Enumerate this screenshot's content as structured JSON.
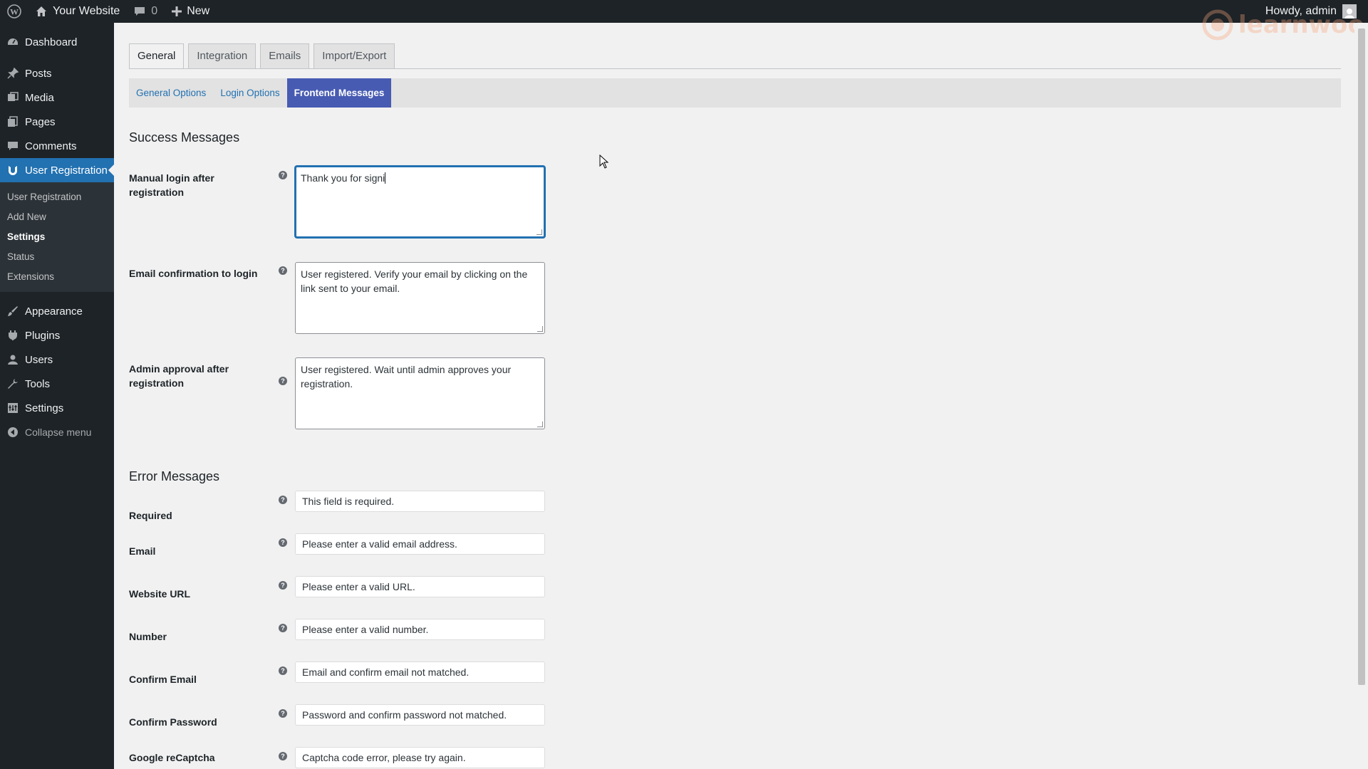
{
  "adminbar": {
    "site_name": "Your Website",
    "comments_count": "0",
    "new_label": "New",
    "howdy": "Howdy, admin"
  },
  "sidebar": {
    "items": [
      {
        "label": "Dashboard",
        "icon": "dashboard-icon"
      },
      {
        "label": "Posts",
        "icon": "pin-icon"
      },
      {
        "label": "Media",
        "icon": "media-icon"
      },
      {
        "label": "Pages",
        "icon": "pages-icon"
      },
      {
        "label": "Comments",
        "icon": "comment-icon"
      },
      {
        "label": "User Registration",
        "icon": "user-registration-icon"
      }
    ],
    "submenu": [
      "User Registration",
      "Add New",
      "Settings",
      "Status",
      "Extensions"
    ],
    "items2": [
      {
        "label": "Appearance",
        "icon": "brush-icon"
      },
      {
        "label": "Plugins",
        "icon": "plug-icon"
      },
      {
        "label": "Users",
        "icon": "users-icon"
      },
      {
        "label": "Tools",
        "icon": "wrench-icon"
      },
      {
        "label": "Settings",
        "icon": "settings-icon"
      }
    ],
    "collapse": "Collapse menu"
  },
  "tabs": [
    "General",
    "Integration",
    "Emails",
    "Import/Export"
  ],
  "subtabs": [
    "General Options",
    "Login Options",
    "Frontend Messages"
  ],
  "success": {
    "title": "Success Messages",
    "fields": [
      {
        "label": "Manual login after registration",
        "value": "Thank you for signi"
      },
      {
        "label": "Email confirmation to login",
        "value": "User registered. Verify your email by clicking on the link sent to your email."
      },
      {
        "label": "Admin approval after registration",
        "value": "User registered. Wait until admin approves your registration."
      }
    ]
  },
  "error": {
    "title": "Error Messages",
    "fields": [
      {
        "label": "Required",
        "value": "This field is required."
      },
      {
        "label": "Email",
        "value": "Please enter a valid email address."
      },
      {
        "label": "Website URL",
        "value": "Please enter a valid URL."
      },
      {
        "label": "Number",
        "value": "Please enter a valid number."
      },
      {
        "label": "Confirm Email",
        "value": "Email and confirm email not matched."
      },
      {
        "label": "Confirm Password",
        "value": "Password and confirm password not matched."
      },
      {
        "label": "Google reCaptcha",
        "value": "Captcha code error, please try again."
      }
    ]
  },
  "help_glyph": "?",
  "watermark": "learnwoo",
  "colors": {
    "accent": "#2271b1",
    "active_subtab": "#475bb2",
    "adminbar": "#1d2327"
  }
}
